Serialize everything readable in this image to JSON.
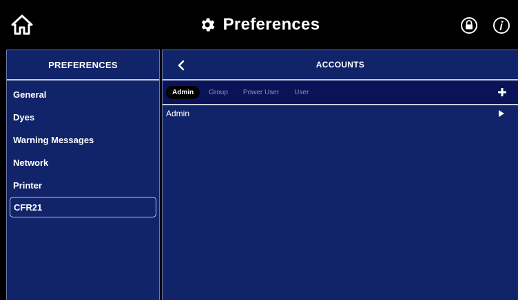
{
  "header": {
    "title": "Preferences",
    "icons": [
      "home-icon",
      "gear-icon",
      "lock-icon",
      "info-icon"
    ]
  },
  "sidebar": {
    "title": "PREFERENCES",
    "items": [
      {
        "label": "General"
      },
      {
        "label": "Dyes"
      },
      {
        "label": "Warning Messages"
      },
      {
        "label": "Network"
      },
      {
        "label": "Printer"
      },
      {
        "label": "CFR21",
        "selected": true
      }
    ]
  },
  "main": {
    "title": "ACCOUNTS",
    "tabs": [
      {
        "label": "Admin",
        "active": true
      },
      {
        "label": "Group"
      },
      {
        "label": "Power User"
      },
      {
        "label": "User"
      }
    ],
    "rows": [
      {
        "label": "Admin"
      }
    ]
  },
  "colors": {
    "panel": "#11246a",
    "tab_bar": "#0a1258",
    "topbar": "#000000",
    "text": "#ffffff"
  }
}
